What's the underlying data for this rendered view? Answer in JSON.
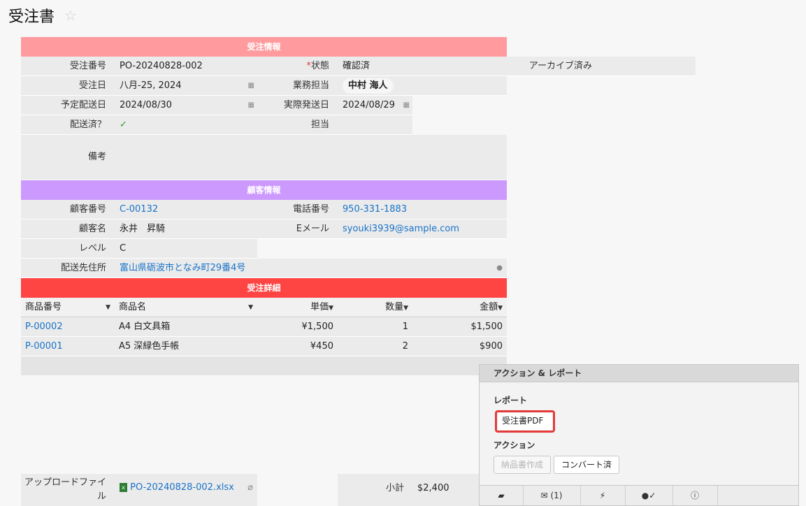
{
  "page": {
    "title": "受注書"
  },
  "order_info": {
    "header": "受注情報",
    "order_no_label": "受注番号",
    "order_no": "PO-20240828-002",
    "required_mark": "*",
    "status_label": "状態",
    "status": "確認済",
    "archived_label": "アーカイブ済み",
    "order_date_label": "受注日",
    "order_date": "八月-25, 2024",
    "staff_label": "業務担当",
    "staff": "中村 海人",
    "planned_label": "予定配送日",
    "planned": "2024/08/30",
    "actual_label": "実際発送日",
    "actual": "2024/08/29",
    "shipped_label": "配送済？",
    "shipped_mark": "✓",
    "assignee_label": "担当",
    "notes_label": "備考"
  },
  "customer_info": {
    "header": "顧客情報",
    "cust_no_label": "顧客番号",
    "cust_no": "C-00132",
    "phone_label": "電話番号",
    "phone": "950-331-1883",
    "name_label": "顧客名",
    "name": "永井　昇騎",
    "email_label": "Eメール",
    "email": "syouki3939@sample.com",
    "level_label": "レベル",
    "level": "C",
    "address_label": "配送先住所",
    "address": "富山県砺波市となみ町29番4号"
  },
  "details": {
    "header": "受注詳細",
    "columns": [
      "商品番号",
      "商品名",
      "単価",
      "数量",
      "金額"
    ],
    "rows": [
      {
        "code": "P-00002",
        "name": "A4 白文具箱",
        "price": "¥1,500",
        "qty": "1",
        "amount": "$1,500"
      },
      {
        "code": "P-00001",
        "name": "A5 深緑色手帳",
        "price": "¥450",
        "qty": "2",
        "amount": "$900"
      }
    ]
  },
  "upload": {
    "label": "アップロードファイル",
    "file": "PO-20240828-002.xlsx"
  },
  "totals": {
    "subtotal_label": "小計",
    "subtotal": "$2,400"
  },
  "action_panel": {
    "header": "アクション & レポート",
    "report_label": "レポート",
    "report_button": "受注書PDF",
    "action_label": "アクション",
    "action_buttons": [
      "納品書作成",
      "コンバート済"
    ],
    "mail_count": "(1)"
  },
  "colors": {
    "order_header": "#ff9b9e",
    "customer_header": "#cc99ff",
    "detail_header": "#ff4444",
    "link": "#1a73c8"
  },
  "icons": [
    "star-icon",
    "calendar-icon",
    "check-icon",
    "map-pin-icon",
    "excel-file-icon",
    "paperclip-icon",
    "comment-icon",
    "mail-icon",
    "bolt-icon",
    "user-check-icon",
    "info-icon",
    "caret-down-icon"
  ]
}
